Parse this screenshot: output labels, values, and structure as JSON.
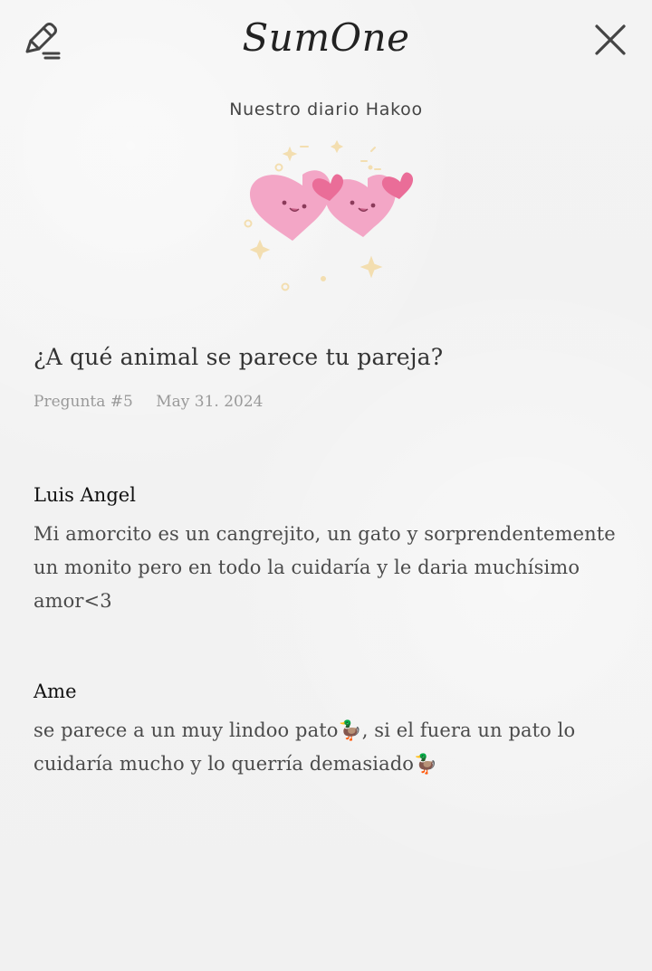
{
  "header": {
    "logo_text": "SumOne",
    "edit_icon": "pencil-icon",
    "close_icon": "close-icon"
  },
  "diary": {
    "title": "Nuestro diario Hakoo"
  },
  "question": {
    "text": "¿A qué animal se parece tu pareja?",
    "number": "Pregunta #5",
    "date": "May 31. 2024"
  },
  "answers": [
    {
      "name": "Luis Angel",
      "text": "Mi amorcito es un cangrejito, un gato y sorprendentemente un monito pero en todo la cuidaría y le daria muchísimo amor<3"
    },
    {
      "name": "Ame",
      "text": "se parece a un muy lindoo pato🦆, si el fuera un pato lo cuidaría mucho y lo querría demasiado🦆"
    }
  ],
  "colors": {
    "heart_pink": "#f3a6c6",
    "heart_dark_pink": "#ea6d98",
    "sparkle_yellow": "#f3deb0"
  }
}
